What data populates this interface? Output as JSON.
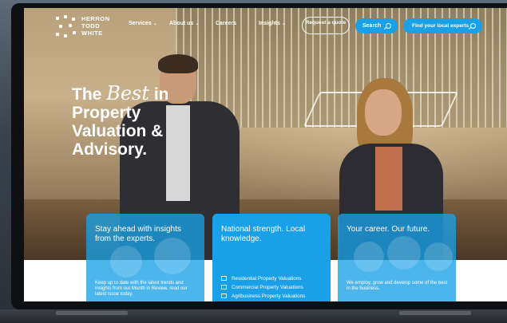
{
  "logo": {
    "lines": [
      "HERRON",
      "TODD",
      "WHITE"
    ]
  },
  "nav": {
    "items": [
      {
        "label": "Services",
        "has_dropdown": true
      },
      {
        "label": "About us",
        "has_dropdown": true
      },
      {
        "label": "Careers",
        "has_dropdown": false
      },
      {
        "label": "Insights",
        "has_dropdown": true
      }
    ],
    "quote_button": "Request a quote",
    "search_button": "Search",
    "experts_button": "Find your local experts"
  },
  "hero": {
    "headline_prefix": "The",
    "headline_script": "Best",
    "headline_suffix": "in",
    "headline_lines": [
      "Property",
      "Valuation &",
      "Advisory."
    ]
  },
  "cards": [
    {
      "title": "Stay ahead with insights from the experts.",
      "body": "Keep up to date with the latest trends and insights from our Month in Review, read our latest issue today."
    },
    {
      "title": "National strength. Local knowledge.",
      "links": [
        {
          "icon": "house-icon",
          "label": "Residential Property Valuations"
        },
        {
          "icon": "building-icon",
          "label": "Commercial Property Valuations"
        },
        {
          "icon": "tractor-icon",
          "label": "Agribusiness Property Valuations"
        }
      ]
    },
    {
      "title": "Your career. Our future.",
      "body": "We employ, grow and develop some of the best in the business."
    }
  ],
  "colors": {
    "accent": "#1aa0e6",
    "text_on_accent": "#ffffff"
  }
}
